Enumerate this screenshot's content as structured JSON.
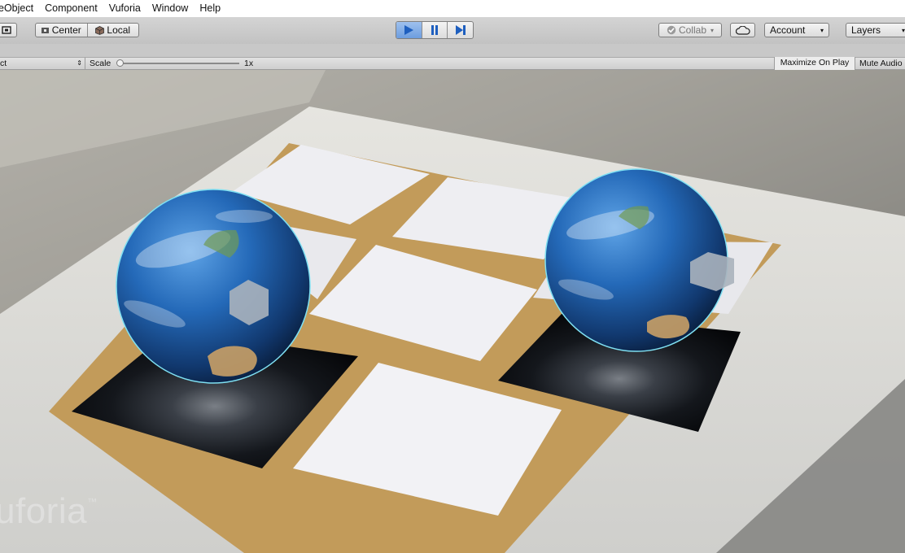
{
  "menu": [
    "eObject",
    "Component",
    "Vuforia",
    "Window",
    "Help"
  ],
  "toolbar": {
    "pivot_center": "Center",
    "pivot_local": "Local",
    "collab": "Collab",
    "account": "Account",
    "layers": "Layers"
  },
  "gameview": {
    "aspect": "ct",
    "scale_label": "Scale",
    "scale_value": "1x",
    "maximize": "Maximize On Play",
    "mute": "Mute Audio"
  },
  "watermark": "uforia",
  "colors": {
    "play_active": "#6d9ddf",
    "play_icon": "#1e5fbf"
  }
}
